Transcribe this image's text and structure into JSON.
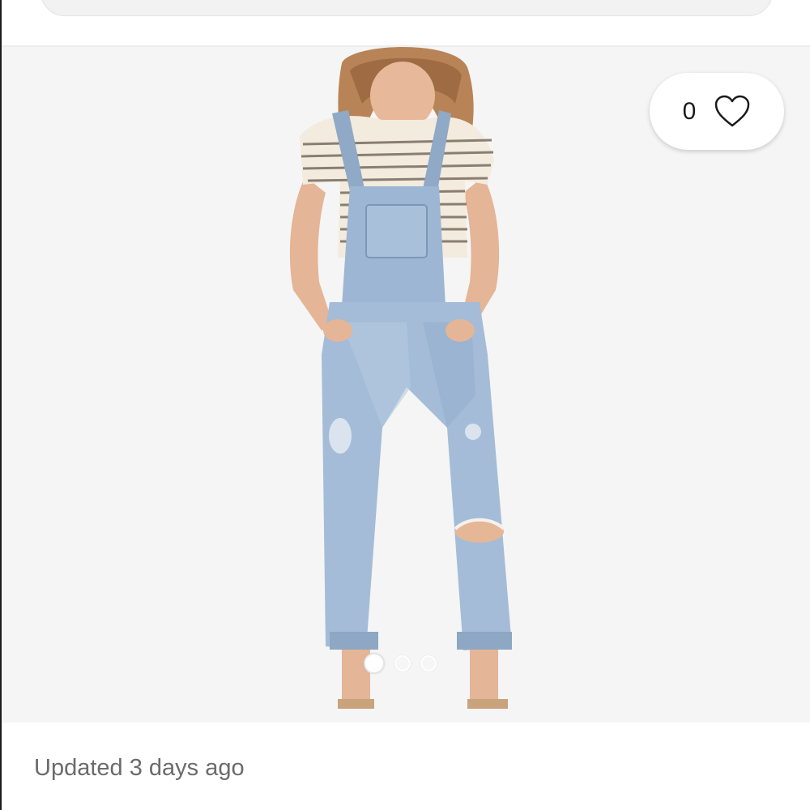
{
  "listing": {
    "like_count": "0",
    "updated_text": "Updated 3 days ago",
    "carousel": {
      "total": 3,
      "active_index": 0
    },
    "icons": {
      "like": "heart-outline-icon"
    }
  },
  "colors": {
    "background": "#ffffff",
    "photo_background": "#f5f5f5",
    "muted_text": "#6b6b6b"
  }
}
